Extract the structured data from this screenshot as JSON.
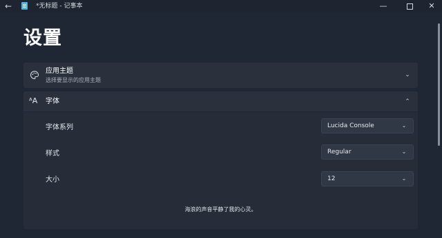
{
  "window": {
    "title": "*无标题 - 记事本",
    "back_glyph": "←",
    "minimize_glyph": "—",
    "close_glyph": "✕"
  },
  "page": {
    "title": "设置"
  },
  "theme_card": {
    "title": "应用主题",
    "subtitle": "选择要显示的应用主题",
    "icon": "palette-icon",
    "expanded": false
  },
  "font_card": {
    "title": "字体",
    "icon": "font-icon",
    "icon_glyph": "ᴬA",
    "expanded": true,
    "rows": {
      "family": {
        "label": "字体系列",
        "value": "Lucida Console"
      },
      "style": {
        "label": "样式",
        "value": "Regular"
      },
      "size": {
        "label": "大小",
        "value": "12"
      }
    },
    "preview_text": "海浪的声音平静了我的心灵。"
  },
  "colors": {
    "background": "#202734",
    "card": "#2a313d",
    "dropdown": "#313845"
  }
}
